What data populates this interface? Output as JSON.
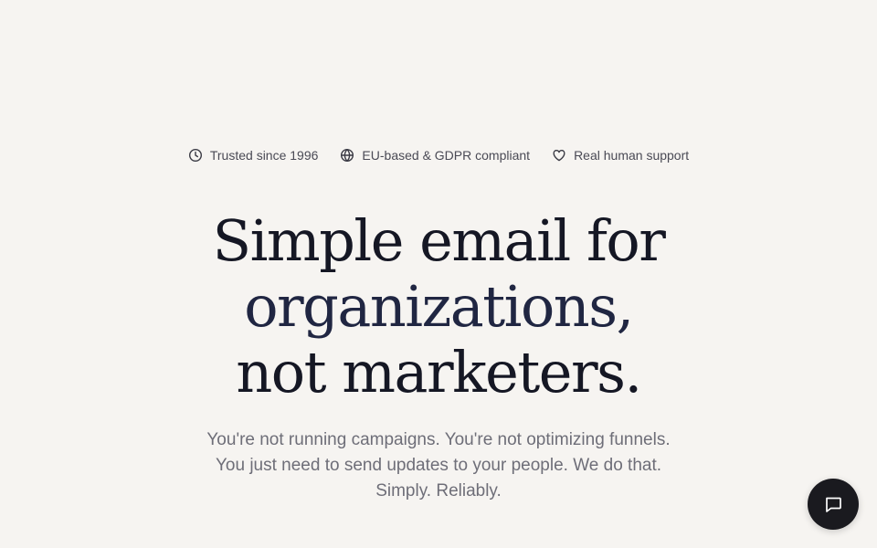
{
  "trust_badges": [
    {
      "icon": "clock-icon",
      "label": "Trusted since 1996"
    },
    {
      "icon": "globe-icon",
      "label": "EU-based & GDPR compliant"
    },
    {
      "icon": "heart-icon",
      "label": "Real human support"
    }
  ],
  "headline": {
    "line1": "Simple email for",
    "line2": "organizations,",
    "line3": "not marketers."
  },
  "subcopy": {
    "line1": "You're not running campaigns. You're not optimizing funnels.",
    "line2": "You just need to send updates to your people. We do that.",
    "line3": "Simply. Reliably."
  },
  "chat": {
    "icon": "chat-bubble-icon"
  },
  "colors": {
    "background": "#f6f4f1",
    "headline": "#151724",
    "body_text": "#6e6e78",
    "chat_button": "#1a1a1f"
  }
}
